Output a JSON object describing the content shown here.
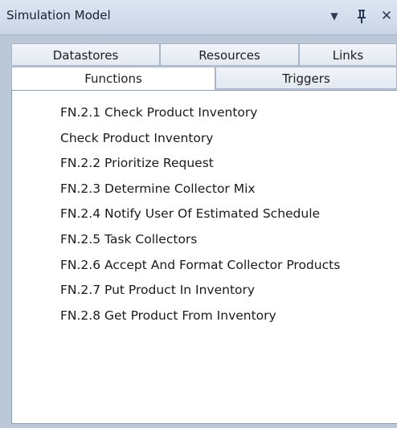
{
  "panel": {
    "title": "Simulation Model",
    "dropdown_icon": "▾",
    "pin_icon": "🞀",
    "close_icon": "✕"
  },
  "tabs": {
    "row1": [
      "Datastores",
      "Resources",
      "Links"
    ],
    "row2": [
      "Functions",
      "Triggers"
    ],
    "active": "Functions"
  },
  "functions": [
    "FN.2.1 Check Product Inventory",
    "Check Product Inventory",
    "FN.2.2 Prioritize Request",
    "FN.2.3 Determine Collector Mix",
    "FN.2.4 Notify User Of Estimated Schedule",
    "FN.2.5 Task Collectors",
    "FN.2.6 Accept And Format Collector Products",
    "FN.2.7 Put Product In Inventory",
    "FN.2.8 Get Product From Inventory"
  ]
}
